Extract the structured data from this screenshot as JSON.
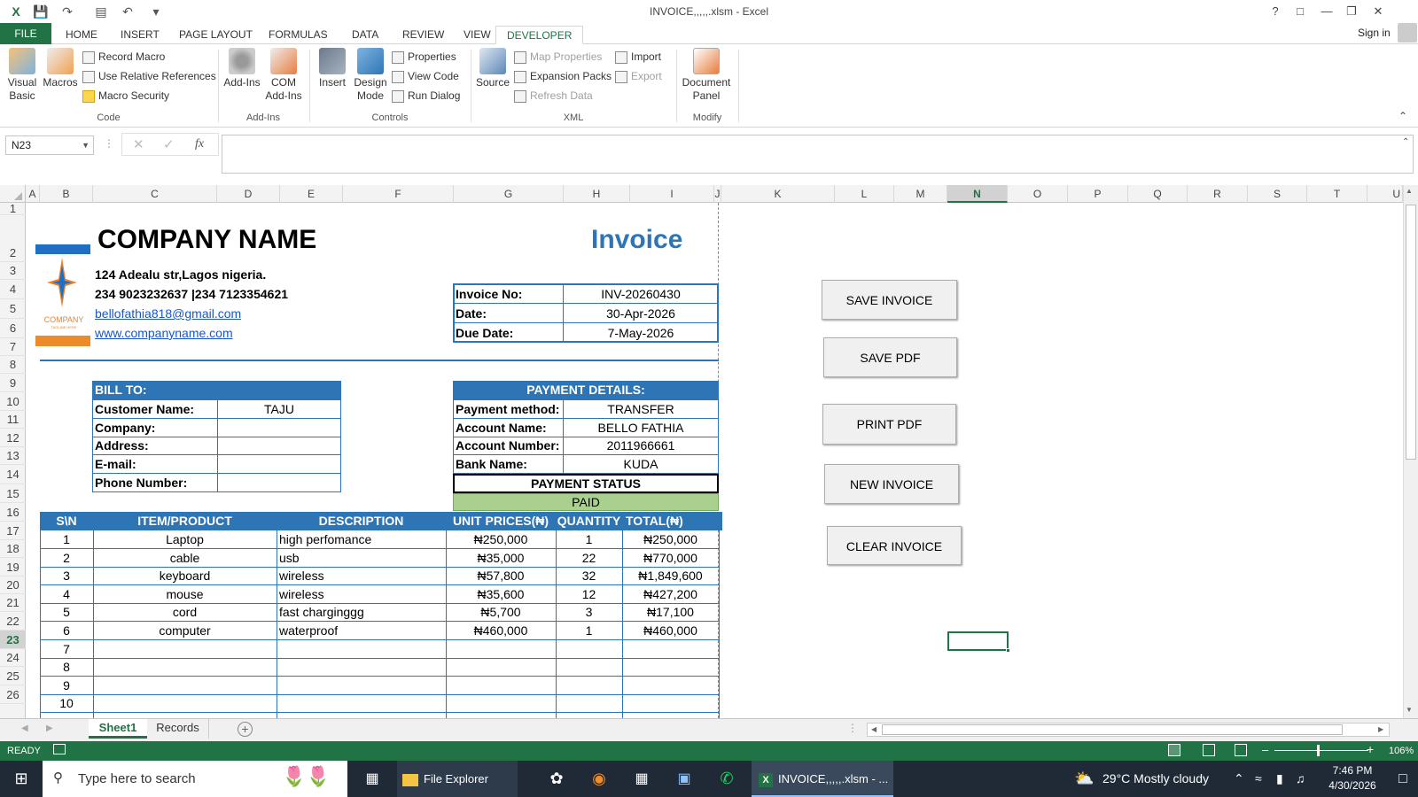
{
  "window": {
    "title": "INVOICE,,,,,.xlsm - Excel",
    "help": "?",
    "sign_in": "Sign in"
  },
  "tabs": [
    "FILE",
    "HOME",
    "INSERT",
    "PAGE LAYOUT",
    "FORMULAS",
    "DATA",
    "REVIEW",
    "VIEW",
    "DEVELOPER"
  ],
  "ribbon": {
    "code": {
      "label": "Code",
      "visual_basic": "Visual Basic",
      "macros": "Macros",
      "record_macro": "Record Macro",
      "relative_refs": "Use Relative References",
      "macro_security": "Macro Security"
    },
    "addins": {
      "label": "Add-Ins",
      "addins": "Add-Ins",
      "com_addins": "COM Add-Ins"
    },
    "controls": {
      "label": "Controls",
      "insert": "Insert",
      "design_mode": "Design Mode",
      "properties": "Properties",
      "view_code": "View Code",
      "run_dialog": "Run Dialog"
    },
    "xml": {
      "label": "XML",
      "source": "Source",
      "map_properties": "Map Properties",
      "expansion_packs": "Expansion Packs",
      "refresh_data": "Refresh Data",
      "import": "Import",
      "export": "Export"
    },
    "modify": {
      "label": "Modify",
      "document_panel": "Document Panel"
    }
  },
  "formula_bar": {
    "name_box": "N23",
    "fx": "fx",
    "value": ""
  },
  "columns": [
    "A",
    "B",
    "C",
    "D",
    "E",
    "F",
    "G",
    "H",
    "I",
    "J",
    "K",
    "L",
    "M",
    "N",
    "O",
    "P",
    "Q",
    "R",
    "S",
    "T",
    "U"
  ],
  "rows": [
    "1",
    "2",
    "3",
    "4",
    "5",
    "6",
    "7",
    "8",
    "9",
    "10",
    "11",
    "12",
    "13",
    "14",
    "15",
    "16",
    "17",
    "18",
    "19",
    "20",
    "21",
    "22",
    "23",
    "24",
    "25",
    "26"
  ],
  "company": {
    "name": "COMPANY NAME",
    "address": "124 Adealu str,Lagos nigeria.",
    "phones": "234 9023232637 |234 7123354621",
    "email": "bellofathia818@gmail.com",
    "website": "www.companyname.com",
    "logo_text": "COMPANY",
    "logo_tagline": "TAGLINE HERE"
  },
  "invoice": {
    "title": "Invoice",
    "no_label": "Invoice No:",
    "no": "INV-20260430",
    "date_label": "Date:",
    "date": "30-Apr-2026",
    "due_label": "Due Date:",
    "due": "7-May-2026"
  },
  "bill_to": {
    "header": "BILL TO:",
    "customer_label": "Customer Name:",
    "customer": "TAJU",
    "company_label": "Company:",
    "address_label": "Address:",
    "email_label": "E-mail:",
    "phone_label": "Phone Number:"
  },
  "payment": {
    "header": "PAYMENT DETAILS:",
    "method_label": "Payment method:",
    "method": "TRANSFER",
    "account_name_label": "Account Name:",
    "account_name": "BELLO FATHIA",
    "account_number_label": "Account Number:",
    "account_number": "2011966661",
    "bank_label": "Bank Name:",
    "bank": "KUDA",
    "status_header": "PAYMENT STATUS",
    "status": "PAID"
  },
  "items_table": {
    "headers": [
      "S\\N",
      "ITEM/PRODUCT",
      "DESCRIPTION",
      "UNIT PRICES(₦)",
      "QUANTITY",
      "TOTAL(₦)"
    ],
    "rows": [
      [
        "1",
        "Laptop",
        "high perfomance",
        "₦250,000",
        "1",
        "₦250,000"
      ],
      [
        "2",
        "cable",
        "usb",
        "₦35,000",
        "22",
        "₦770,000"
      ],
      [
        "3",
        "keyboard",
        "wireless",
        "₦57,800",
        "32",
        "₦1,849,600"
      ],
      [
        "4",
        "mouse",
        "wireless",
        "₦35,600",
        "12",
        "₦427,200"
      ],
      [
        "5",
        "cord",
        "fast charginggg",
        "₦5,700",
        "3",
        "₦17,100"
      ],
      [
        "6",
        "computer",
        "waterproof",
        "₦460,000",
        "1",
        "₦460,000"
      ],
      [
        "7",
        "",
        "",
        "",
        "",
        ""
      ],
      [
        "8",
        "",
        "",
        "",
        "",
        ""
      ],
      [
        "9",
        "",
        "",
        "",
        "",
        ""
      ],
      [
        "10",
        "",
        "",
        "",
        "",
        ""
      ]
    ]
  },
  "macro_buttons": {
    "save_invoice": "SAVE INVOICE",
    "save_pdf": "SAVE PDF",
    "print_pdf": "PRINT PDF",
    "new_invoice": "NEW INVOICE",
    "clear_invoice": "CLEAR INVOICE"
  },
  "sheets": [
    "Sheet1",
    "Records"
  ],
  "status": {
    "ready": "READY",
    "zoom": "106%"
  },
  "taskbar": {
    "search_placeholder": "Type here to search",
    "file_explorer": "File Explorer",
    "excel_task": "INVOICE,,,,,.xlsm - ...",
    "weather": "29°C  Mostly cloudy",
    "time": "7:46 PM",
    "date": "4/30/2026"
  },
  "colors": {
    "excel_green": "#217346",
    "header_blue": "#2e75b6",
    "paid_green": "#a9d08e",
    "invoice_blue": "#2e75b6"
  }
}
